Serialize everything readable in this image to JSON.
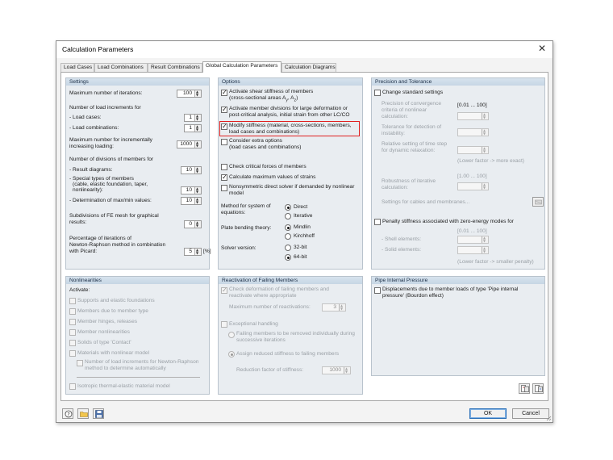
{
  "window": {
    "title": "Calculation Parameters",
    "close_glyph": "✕"
  },
  "tabs": [
    {
      "label": "Load Cases"
    },
    {
      "label": "Load Combinations"
    },
    {
      "label": "Result Combinations"
    },
    {
      "label": "Global Calculation Parameters",
      "active": true
    },
    {
      "label": "Calculation Diagrams"
    }
  ],
  "settings": {
    "header": "Settings",
    "max_iterations_label": "Maximum number of iterations:",
    "max_iterations": "100",
    "load_increments_label": "Number of load increments for",
    "load_cases_label": "- Load cases:",
    "load_cases": "1",
    "load_combinations_label": "- Load combinations:",
    "load_combinations": "1",
    "max_incr_label_1": "Maximum number for incrementally",
    "max_incr_label_2": "increasing loading:",
    "max_incr": "1000",
    "divisions_label": "Number of divisions of members for",
    "result_diagrams_label": "- Result diagrams:",
    "result_diagrams": "10",
    "special_label_1": "- Special types of members",
    "special_label_2": "(cable, elastic foundation, taper,",
    "special_label_3": "nonlinearity):",
    "special": "10",
    "determination_label": "- Determination of max/min values:",
    "determination": "10",
    "subdiv_label_1": "Subdivisions of FE mesh for graphical",
    "subdiv_label_2": "results:",
    "subdiv": "0",
    "percent_label_1": "Percentage of iterations of",
    "percent_label_2": "Newton-Raphson method in combination",
    "percent_label_3": "with Picard:",
    "percent": "5",
    "percent_unit": "[%]"
  },
  "options": {
    "header": "Options",
    "shear_1": "Activate shear stiffness of members",
    "shear_2": "(cross-sectional areas A",
    "shear_sub_y": "y",
    "shear_mid": ", A",
    "shear_sub_z": "z",
    "shear_end": ")",
    "divisions_1": "Activate member divisions for large deformation or",
    "divisions_2": "post-critical analysis, initial strain from other LC/CO",
    "modify_1": "Modify stiffness (material, cross-sections, members,",
    "modify_2": "load cases and combinations)",
    "extra_1": "Consider extra options",
    "extra_2": "(load cases and combinations)",
    "critical": "Check critical forces of members",
    "strains": "Calculate maximum values of strains",
    "nonsym_1": "Nonsymmetric direct solver if demanded by nonlinear",
    "nonsym_2": "model",
    "method_label_1": "Method for system of",
    "method_label_2": "equations:",
    "method_direct": "Direct",
    "method_iterative": "Iterative",
    "plate_label": "Plate bending theory:",
    "plate_mindlin": "Mindlin",
    "plate_kirchhoff": "Kirchhoff",
    "solver_label": "Solver version:",
    "solver_32": "32-bit",
    "solver_64": "64-bit"
  },
  "precision": {
    "header": "Precision and Tolerance",
    "change_label": "Change standard settings",
    "conv_1": "Precision of convergence",
    "conv_2": "criteria of nonlinear",
    "conv_3": "calculation:",
    "range_1": "[0.01 ... 100]",
    "tol_1": "Tolerance for detection of",
    "tol_2": "instability:",
    "relax_1": "Relative setting of time step",
    "relax_2": "for dynamic relaxation:",
    "lower_exact": "(Lower factor -> more exact)",
    "range_2": "[1.00 ... 100]",
    "robust_1": "Robustness of iterative",
    "robust_2": "calculation:",
    "cables": "Settings for cables and membranes...",
    "penalty": "Penalty stiffness associated with zero-energy modes for",
    "range_3": "[0.01 ... 100]",
    "shell": "- Shell elements:",
    "solid": "- Solid elements:",
    "lower_penalty": "(Lower factor -> smaller penalty)"
  },
  "nonlinearities": {
    "header": "Nonlinearities",
    "activate": "Activate:",
    "supports": "Supports and elastic foundations",
    "member_type": "Members due to member type",
    "hinges": "Member hinges, releases",
    "member_nonlin": "Member nonlinearities",
    "contact": "Solids of type 'Contact'",
    "materials": "Materials with nonlinear model",
    "load_incr_1": "Number of load increments for Newton-Raphson",
    "load_incr_2": "method to determine automatically",
    "isotropic": "Isotropic thermal-elastic material model"
  },
  "reactivation": {
    "header": "Reactivation of Failing Members",
    "check_1": "Check deformation of failing members and",
    "check_2": "reactivate where appropriate",
    "max_label": "Maximum number of reactivations:",
    "max_value": "3",
    "exceptional": "Exceptional handling",
    "remove_1": "Failing members to be removed individually during",
    "remove_2": "successive iterations",
    "assign": "Assign reduced stiffness to failing members",
    "reduction_label": "Reduction factor of stiffness:",
    "reduction_value": "1000"
  },
  "pipe": {
    "header": "Pipe Internal Pressure",
    "disp_1": "Displacements due to member loads of type 'Pipe internal",
    "disp_2": "pressure' (Bourdon effect)"
  },
  "footer": {
    "ok": "OK",
    "cancel": "Cancel"
  },
  "colors": {
    "highlight": "#e02020",
    "panel_head": "#c6d6e5",
    "default_button": "#2a6fb8"
  }
}
